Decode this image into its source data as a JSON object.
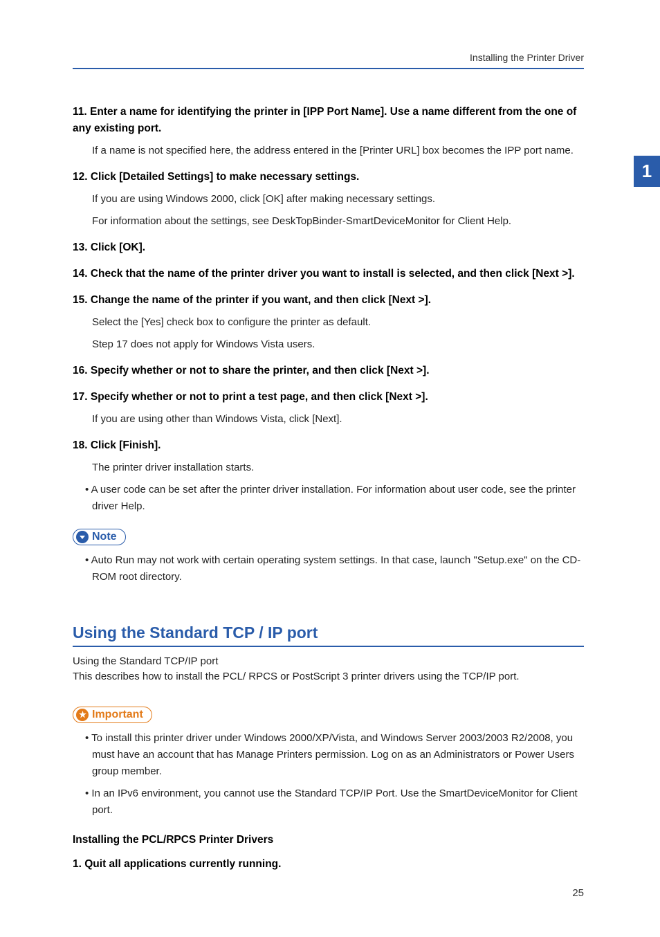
{
  "header": {
    "title": "Installing the Printer Driver"
  },
  "sideTab": "1",
  "steps": {
    "s11": "11. Enter a name for identifying the printer in [IPP Port Name]. Use a name different from the one of any existing port.",
    "s11_body": "If a name is not specified here, the address entered in the [Printer URL] box becomes the IPP port name.",
    "s12": "12. Click [Detailed Settings] to make necessary settings.",
    "s12_body1": "If you are using Windows 2000, click [OK] after making necessary settings.",
    "s12_body2": "For information about the settings, see DeskTopBinder-SmartDeviceMonitor for Client Help.",
    "s13": "13. Click [OK].",
    "s14": "14. Check that the name of the printer driver you want to install is selected, and then click [Next >].",
    "s15": "15. Change the name of the printer if you want, and then click [Next >].",
    "s15_body1": "Select the [Yes] check box to configure the printer as default.",
    "s15_body2": "Step 17 does not apply for Windows Vista users.",
    "s16": "16. Specify whether or not to share the printer, and then click [Next >].",
    "s17": "17. Specify whether or not to print a test page, and then click [Next >].",
    "s17_body": "If you are using other than Windows Vista, click [Next].",
    "s18": "18. Click [Finish].",
    "s18_body": "The printer driver installation starts.",
    "bullet_usercode": "• A user code can be set after the printer driver installation. For information about user code, see the printer driver Help."
  },
  "note": {
    "label": "Note",
    "bullet": "• Auto Run may not work with certain operating system settings. In that case, launch \"Setup.exe\" on the CD-ROM root directory."
  },
  "section": {
    "heading": "Using the Standard TCP / IP port",
    "line1": "Using the Standard TCP/IP port",
    "line2": "This describes how to install the PCL/ RPCS or PostScript 3 printer drivers using the TCP/IP port."
  },
  "important": {
    "label": "Important",
    "bullet1": "• To install this printer driver under Windows 2000/XP/Vista, and Windows Server 2003/2003 R2/2008, you must have an account that has Manage Printers permission. Log on as an Administrators or Power Users group member.",
    "bullet2": "• In an IPv6 environment, you cannot use the Standard TCP/IP Port. Use the SmartDeviceMonitor for Client port."
  },
  "subheading": "Installing the PCL/RPCS Printer Drivers",
  "step1_new": "1. Quit all applications currently running.",
  "pageNumber": "25"
}
